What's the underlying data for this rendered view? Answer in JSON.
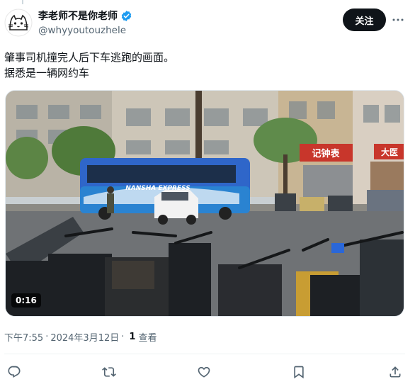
{
  "author": {
    "display_name": "李老师不是你老师",
    "handle": "@whyyoutouzhele",
    "verified": true,
    "avatar_icon": "cat-avatar-icon"
  },
  "actions_top": {
    "follow_label": "关注",
    "more_icon": "more-icon"
  },
  "tweet": {
    "line1": "肇事司机撞完人后下车逃跑的画面。",
    "line2": "据悉是一辆网约车"
  },
  "media": {
    "duration": "0:16",
    "bus_text": "NANSHA EXPRESS",
    "shop_sign_1": "记钟表",
    "shop_sign_2": "大医"
  },
  "meta": {
    "time": "下午7:55",
    "date": "2024年3月12日",
    "separator": "·",
    "views_count": "1",
    "views_label": "查看"
  },
  "action_bar": {
    "reply_icon": "reply-icon",
    "retweet_icon": "retweet-icon",
    "like_icon": "like-icon",
    "bookmark_icon": "bookmark-icon",
    "share_icon": "share-icon"
  },
  "colors": {
    "accent": "#1d9bf0",
    "text": "#0f1419",
    "muted": "#536471",
    "button_bg": "#0f1419"
  }
}
